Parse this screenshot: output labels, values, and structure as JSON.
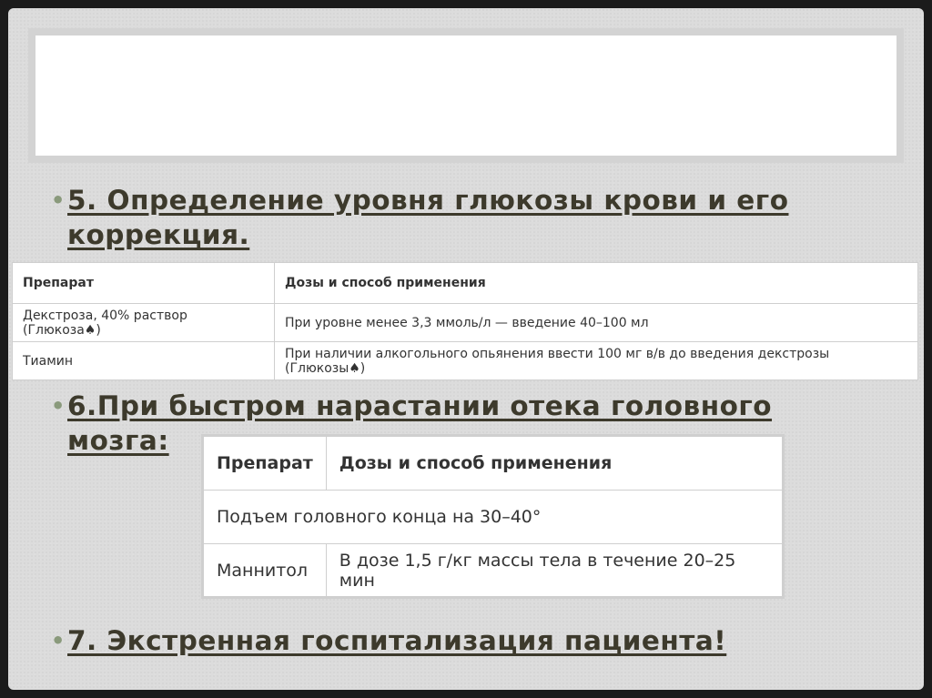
{
  "section5": {
    "bullet": "•",
    "heading_line1": "5. Определение уровня глюкозы крови и его",
    "heading_line2": "коррекция."
  },
  "table1": {
    "headers": [
      "Препарат",
      "Дозы и способ применения"
    ],
    "rows": [
      [
        "Декстроза, 40% раствор (Глюкоза♠)",
        "При уровне менее 3,3 ммоль/л — введение 40–100 мл"
      ],
      [
        "Тиамин",
        "При наличии алкогольного опьянения ввести 100 мг в/в до введения декстрозы (Глюкозы♠)"
      ]
    ]
  },
  "section6": {
    "bullet": "•",
    "heading_line1": "6.При быстром нарастании отека головного",
    "heading_line2": "мозга:"
  },
  "table2": {
    "headers": [
      "Препарат",
      "Дозы и способ применения"
    ],
    "full_row": "Подъем головного конца на 30–40°",
    "rows": [
      [
        "Маннитол",
        "В дозе 1,5 г/кг массы тела в течение 20–25 мин"
      ]
    ]
  },
  "section7": {
    "bullet": "•",
    "heading": "7. Экстренная госпитализация пациента!"
  }
}
